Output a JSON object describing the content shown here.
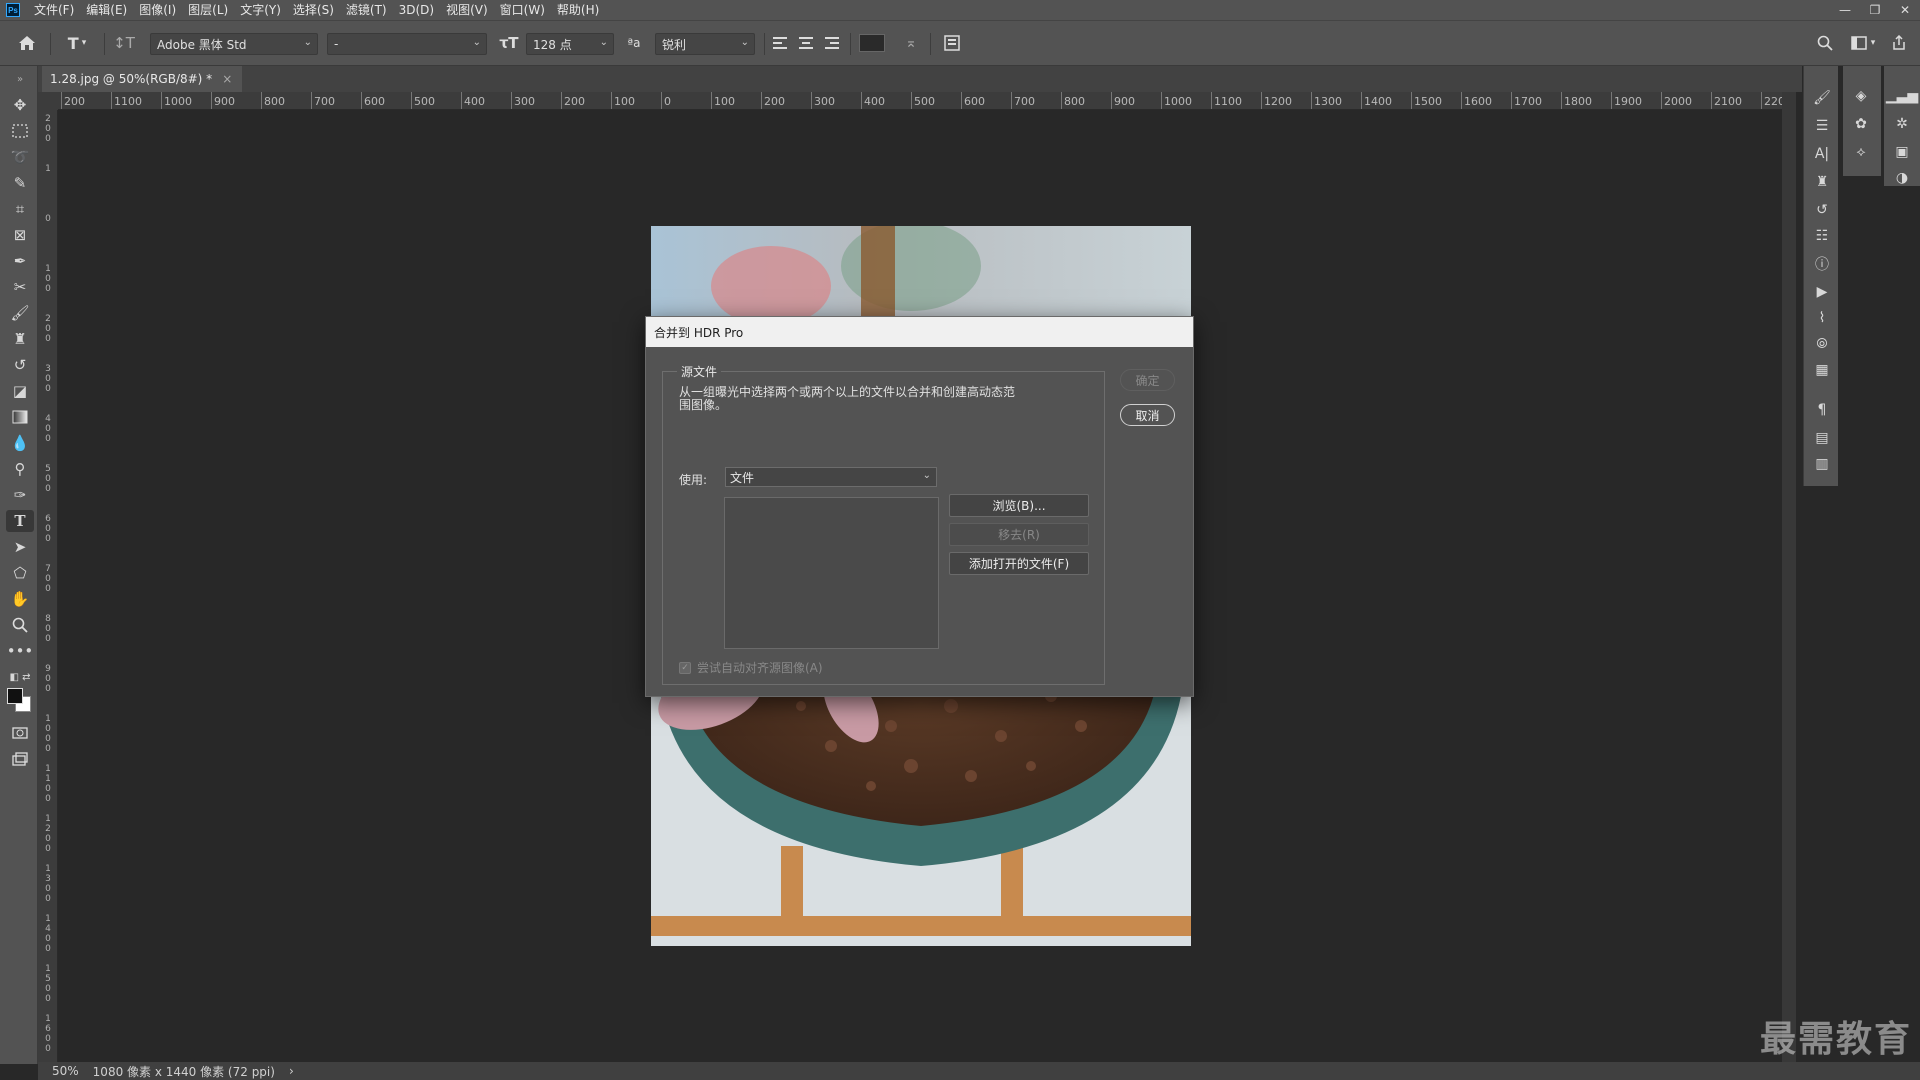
{
  "menubar": {
    "logo": "Ps",
    "items": [
      "文件(F)",
      "编辑(E)",
      "图像(I)",
      "图层(L)",
      "文字(Y)",
      "选择(S)",
      "滤镜(T)",
      "3D(D)",
      "视图(V)",
      "窗口(W)",
      "帮助(H)"
    ]
  },
  "window_controls": {
    "minimize": "—",
    "restore": "❐",
    "close": "✕"
  },
  "options": {
    "font_family": "Adobe 黑体 Std",
    "font_style": "-",
    "font_size": "128 点",
    "aa_icon_label": "ªa",
    "antialias": "锐利"
  },
  "tab": {
    "title": "1.28.jpg @ 50%(RGB/8#) *",
    "close": "×"
  },
  "ruler": {
    "h_ticks": [
      "200",
      "1100",
      "1000",
      "900",
      "800",
      "700",
      "600",
      "500",
      "400",
      "300",
      "200",
      "100",
      "0",
      "100",
      "200",
      "300",
      "400",
      "500",
      "600",
      "700",
      "800",
      "900",
      "1000",
      "1100",
      "1200",
      "1300",
      "1400",
      "1500",
      "1600",
      "1700",
      "1800",
      "1900",
      "2000",
      "2100",
      "2200"
    ],
    "v_ticks": [
      "200",
      "1",
      "0",
      "100",
      "200",
      "300",
      "400",
      "500",
      "600",
      "700",
      "800",
      "900",
      "1000",
      "1100",
      "1200",
      "1300",
      "1400",
      "1500",
      "1600"
    ]
  },
  "dialog": {
    "title": "合并到 HDR Pro",
    "group_label": "源文件",
    "description": "从一组曝光中选择两个或两个以上的文件以合并和创建高动态范围图像。",
    "use_label": "使用:",
    "use_value": "文件",
    "browse": "浏览(B)...",
    "remove": "移去(R)",
    "add_open": "添加打开的文件(F)",
    "align_checkbox": "尝试自动对齐源图像(A)",
    "ok": "确定",
    "cancel": "取消"
  },
  "status": {
    "zoom": "50%",
    "doc_info": "1080 像素 x 1440 像素 (72 ppi)",
    "arrow": "›"
  },
  "watermark": "最需教育"
}
